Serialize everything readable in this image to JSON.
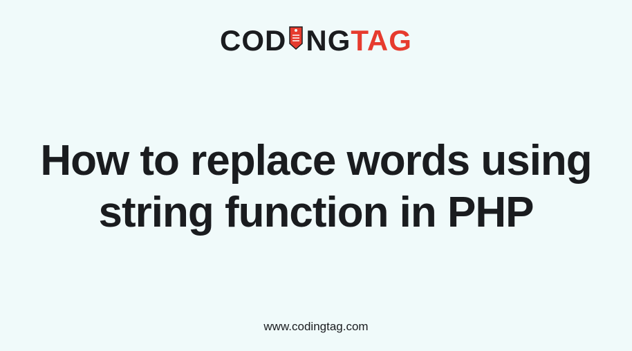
{
  "logo": {
    "part1": "COD",
    "part2": "NG",
    "part3": "TAG"
  },
  "headline": "How to replace words using string function in PHP",
  "footer": {
    "url": "www.codingtag.com"
  }
}
